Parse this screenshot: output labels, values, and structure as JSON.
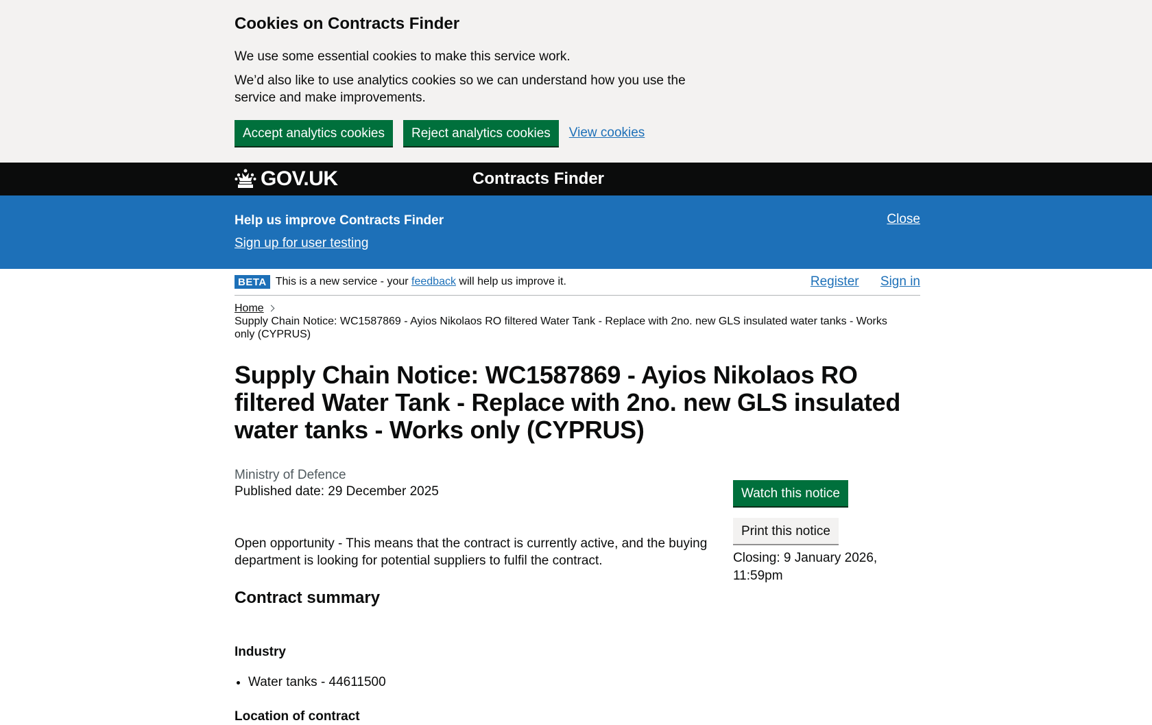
{
  "cookie": {
    "title": "Cookies on Contracts Finder",
    "p1": "We use some essential cookies to make this service work.",
    "p2": "We’d also like to use analytics cookies so we can understand how you use the service and make improvements.",
    "accept": "Accept analytics cookies",
    "reject": "Reject analytics cookies",
    "view": "View cookies"
  },
  "header": {
    "logo": "GOV.UK",
    "service": "Contracts Finder"
  },
  "research": {
    "title": "Help us improve Contracts Finder",
    "link": "Sign up for user testing",
    "close": "Close"
  },
  "phase": {
    "tag": "BETA",
    "text_before": "This is a new service - your",
    "link": "feedback",
    "text_after": "will help us improve it.",
    "register": "Register",
    "signin": "Sign in"
  },
  "breadcrumb": {
    "home": "Home",
    "current": "Supply Chain Notice: WC1587869 - Ayios Nikolaos RO filtered Water Tank - Replace with 2no. new GLS insulated water tanks - Works only (CYPRUS)"
  },
  "notice": {
    "title": "Supply Chain Notice: WC1587869 - Ayios Nikolaos RO filtered Water Tank - Replace with 2no. new GLS insulated water tanks - Works only (CYPRUS)",
    "organisation": "Ministry of Defence",
    "published": "Published date: 29 December 2025",
    "status": "Open opportunity - This means that the contract is currently active, and the buying department is looking for potential suppliers to fulfil the contract.",
    "summary_heading": "Contract summary",
    "industry_heading": "Industry",
    "industry_items": [
      "Water tanks - 44611500"
    ],
    "location_heading": "Location of contract"
  },
  "actions": {
    "watch": "Watch this notice",
    "print": "Print this notice",
    "closing": "Closing: 9 January 2026, 11:59pm"
  }
}
